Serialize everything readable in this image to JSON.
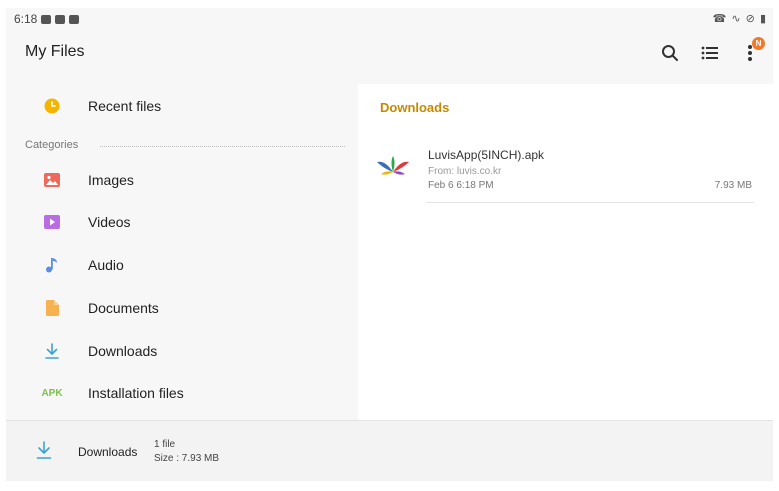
{
  "status_bar": {
    "time": "6:18",
    "right_icons": "☎ ∿ ⊘ ▮"
  },
  "app_bar": {
    "title": "My Files",
    "notification_badge": "N"
  },
  "sidebar": {
    "recent": {
      "label": "Recent files",
      "icon": "clock-icon",
      "color": "#f4b400"
    },
    "categories_label": "Categories",
    "items": [
      {
        "label": "Images",
        "icon": "image-icon",
        "color": "#ef6a5a"
      },
      {
        "label": "Videos",
        "icon": "video-icon",
        "color": "#b86de6"
      },
      {
        "label": "Audio",
        "icon": "audio-icon",
        "color": "#5a8ee6"
      },
      {
        "label": "Documents",
        "icon": "document-icon",
        "color": "#f6b24e"
      },
      {
        "label": "Downloads",
        "icon": "download-icon",
        "color": "#3aa3d6"
      },
      {
        "label": "Installation files",
        "icon": "apk-icon",
        "icon_text": "APK",
        "color": "#7cc04a"
      }
    ]
  },
  "content": {
    "title": "Downloads",
    "files": [
      {
        "name": "LuvisApp(5INCH).apk",
        "from": "From: luvis.co.kr",
        "date": "Feb 6 6:18 PM",
        "size": "7.93 MB"
      }
    ]
  },
  "bottom_bar": {
    "label": "Downloads",
    "count": "1 file",
    "size": "Size : 7.93 MB"
  },
  "colors": {
    "accent": "#c48a00",
    "panel": "#f7f7f7"
  }
}
